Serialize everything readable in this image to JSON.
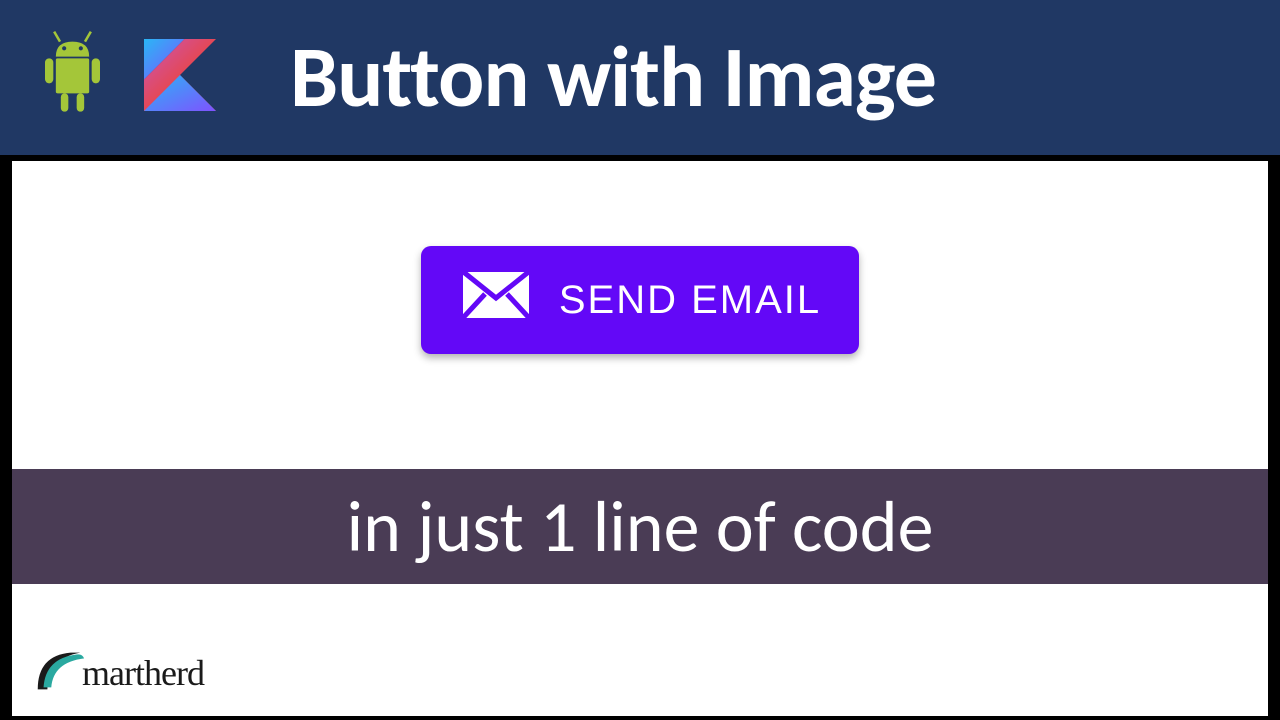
{
  "header": {
    "title": "Button with Image"
  },
  "button": {
    "label": "SEND EMAIL"
  },
  "subtitle": "in just 1 line of code",
  "brand": {
    "name": "martherd"
  },
  "colors": {
    "header_bg": "#203864",
    "button_bg": "#6308f7",
    "subtitle_bg": "#4a3c55",
    "android_green": "#a4c639",
    "kotlin_orange": "#f88909",
    "kotlin_purple": "#7f52ff"
  }
}
